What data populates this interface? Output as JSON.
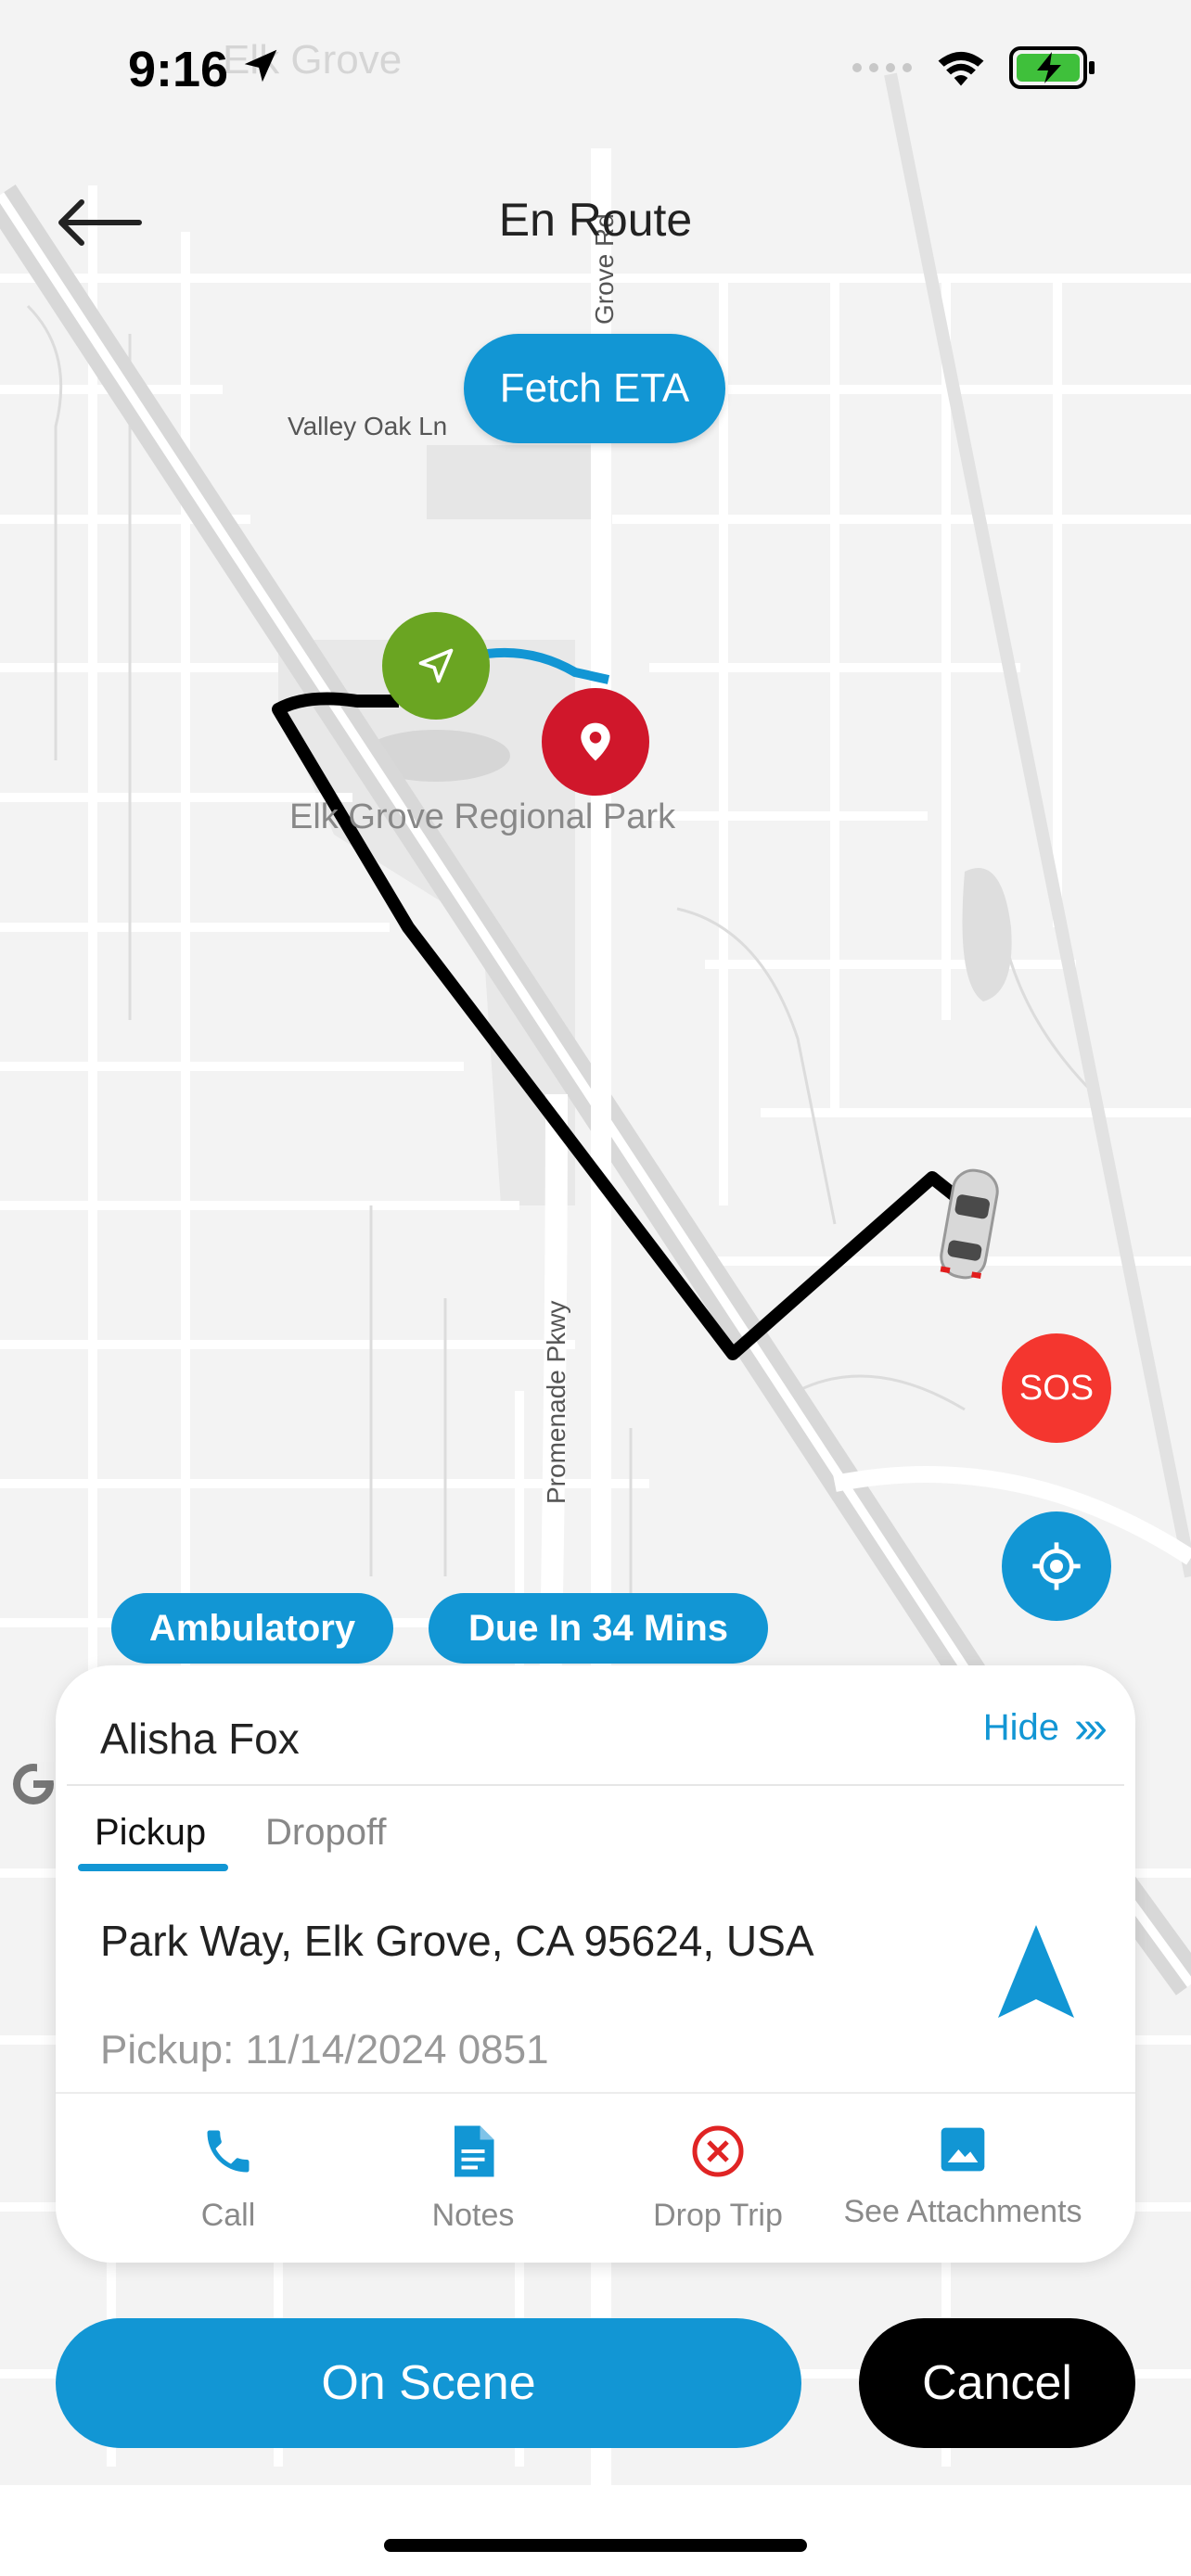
{
  "status_bar": {
    "time": "9:16",
    "icons": [
      "location-arrow-icon",
      "signal-dots-icon",
      "wifi-icon",
      "battery-charging-icon"
    ]
  },
  "header": {
    "title": "En Route"
  },
  "map": {
    "fetch_eta_label": "Fetch ETA",
    "labels": {
      "valley_oak": "Valley Oak Ln",
      "grove_rd": "Grove Rd",
      "elk_grove_faded": "Elk Grove",
      "park": "Elk Grove Regional Park",
      "promenade": "Promenade Pkwy"
    },
    "sos_label": "SOS"
  },
  "chips": {
    "mobility": "Ambulatory",
    "due": "Due In 34 Mins"
  },
  "trip_card": {
    "passenger_name": "Alisha Fox",
    "hide_label": "Hide",
    "hide_chevrons": "›››",
    "tabs": [
      {
        "label": "Pickup",
        "active": true
      },
      {
        "label": "Dropoff",
        "active": false
      }
    ],
    "address": "Park Way, Elk Grove, CA 95624, USA",
    "pickup_time": "Pickup: 11/14/2024 0851",
    "actions": [
      {
        "label": "Call",
        "icon": "phone-icon"
      },
      {
        "label": "Notes",
        "icon": "notes-icon"
      },
      {
        "label": "Drop Trip",
        "icon": "drop-trip-icon"
      },
      {
        "label": "See Attachments",
        "icon": "image-icon"
      }
    ]
  },
  "footer": {
    "primary_label": "On Scene",
    "secondary_label": "Cancel"
  },
  "colors": {
    "accent": "#1296d4",
    "sos": "#f4362f",
    "pickup_marker": "#6aa522",
    "dropoff_marker": "#d0172b",
    "route": "#000000"
  }
}
